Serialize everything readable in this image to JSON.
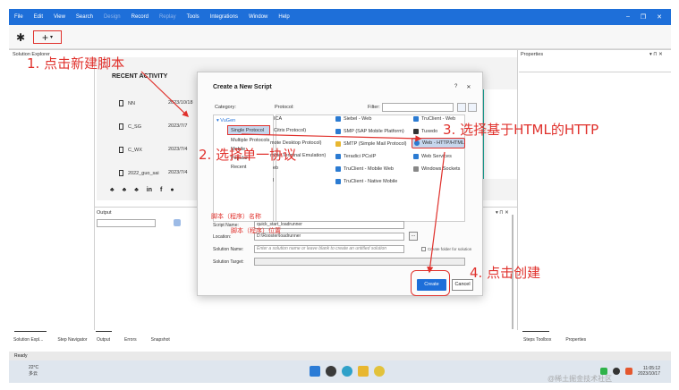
{
  "menubar": {
    "items": [
      {
        "label": "File",
        "disabled": false
      },
      {
        "label": "Edit",
        "disabled": false
      },
      {
        "label": "View",
        "disabled": false
      },
      {
        "label": "Search",
        "disabled": false
      },
      {
        "label": "Design",
        "disabled": true
      },
      {
        "label": "Record",
        "disabled": false
      },
      {
        "label": "Replay",
        "disabled": true
      },
      {
        "label": "Tools",
        "disabled": false
      },
      {
        "label": "Integrations",
        "disabled": false
      },
      {
        "label": "Window",
        "disabled": false
      },
      {
        "label": "Help",
        "disabled": false
      }
    ],
    "minimize": "–",
    "restore": "❐",
    "close": "✕"
  },
  "toolbar": {
    "new_script_glyph": "✱",
    "add_glyph": "+",
    "add_caret": "▾"
  },
  "solution_explorer": {
    "title": "Solution Explorer"
  },
  "start_page": {
    "recent_title": "RECENT ACTIVITY",
    "items": [
      {
        "name": "NN",
        "date": "2023/10/18"
      },
      {
        "name": "C_SG",
        "date": "2023/7/7"
      },
      {
        "name": "C_WX",
        "date": "2023/7/4"
      },
      {
        "name": "2022_guo_sai",
        "date": "2023/7/4"
      }
    ],
    "social": [
      "♣",
      "♣",
      "♣",
      "in",
      "f",
      "●"
    ]
  },
  "output": {
    "title": "Output"
  },
  "properties": {
    "title": "Properties"
  },
  "panel_controls": "▾ ⊓ ✕",
  "bottom_tabs": {
    "left": [
      "Solution Expl...",
      "Step Navigator"
    ],
    "middle": [
      "Output",
      "Errors",
      "Snapshot"
    ],
    "right": [
      "Steps Toolbox",
      "Properties"
    ]
  },
  "status": {
    "text": "Ready"
  },
  "taskbar": {
    "temp": "22°C",
    "weather": "多云",
    "time": "11:05:12",
    "date": "2023/10/17"
  },
  "dialog": {
    "title": "Create a New Script",
    "help_glyph": "?",
    "close_glyph": "✕",
    "category_label": "Category:",
    "protocol_label": "Protocol:",
    "filter_label": "Filter:",
    "categories": [
      {
        "label": "▾ VuGen"
      },
      {
        "label": "Single Protocol"
      },
      {
        "label": "Multiple Protocols"
      },
      {
        "label": "Mobile"
      },
      {
        "label": "Popular"
      },
      {
        "label": "Recent"
      }
    ],
    "protocols_col1": [
      "ICA",
      "Citrix Protocol)",
      "mote Desktop Protocol)",
      "mote Terminal Emulation)",
      "eb",
      "l"
    ],
    "protocols_col2": [
      "Siebel - Web",
      "SMP (SAP Mobile Platform)",
      "SMTP (Simple Mail Protocol)",
      "Teradici PCoIP",
      "TruClient - Mobile Web",
      "TruClient - Native Mobile"
    ],
    "protocols_col3": [
      "TruClient - Web",
      "Tuxedo",
      "Web - HTTP/HTML",
      "Web Services",
      "Windows Sockets"
    ],
    "script_name_label": "Script Name:",
    "script_name_value": "quick_start_loadrunner",
    "location_label": "Location:",
    "location_value": "D:\\Rooster\\loadrunner",
    "solution_name_label": "Solution Name:",
    "solution_name_placeholder": "Enter a solution name or leave blank to create an untitled solution",
    "solution_target_label": "Solution Target:",
    "create_folder_label": "Create folder for solution",
    "browse_label": "...",
    "create_button": "Create",
    "cancel_button": "Cancel"
  },
  "annotations": {
    "step1": "1. 点击新建脚本",
    "step2": "2. 选择单一协议",
    "step3": "3. 选择基于HTML的HTTP",
    "step4": "4. 点击创建",
    "script_name_note": "脚本（程序）名称",
    "location_note": "脚本（程序）位置"
  },
  "watermark": "@稀土掘金技术社区",
  "colors": {
    "accent": "#1e6fd9",
    "annotation": "#e0312c"
  }
}
